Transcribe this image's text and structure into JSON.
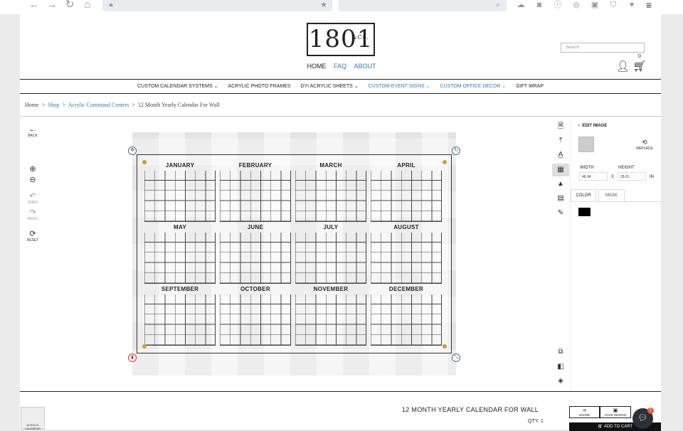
{
  "browser": {
    "back_icon": "arrow-left-icon",
    "forward_icon": "arrow-right-icon",
    "reload_icon": "reload-icon",
    "home_icon": "home-icon"
  },
  "logo": {
    "text": "1801",
    "suffix": "&Co."
  },
  "topnav": {
    "home": "HOME",
    "faq": "FAQ",
    "about": "ABOUT"
  },
  "search": {
    "placeholder": "Search"
  },
  "cart": {
    "count": "0"
  },
  "mainnav": [
    "CUSTOM CALENDAR SYSTEMS ⌄",
    "ACRYLIC PHOTO FRAMES",
    "DYI ACRYLIC SHEETS ⌄",
    "CUSTOM EVENT SIGNS ⌄",
    "CUSTOM OFFICE DECOR ⌄",
    "GIFT WRAP"
  ],
  "breadcrumb": {
    "home": "Home",
    "shop": "Shop",
    "category": "Acrylic Command Centers",
    "current": "12 Month Yearly Calendar For Wall",
    "sep": ">"
  },
  "left_tools": {
    "back": "BACK",
    "undo": "UNDO",
    "redo": "REDO",
    "reset": "RESET"
  },
  "calendar": {
    "months": [
      "JANUARY",
      "FEBRUARY",
      "MARCH",
      "APRIL",
      "MAY",
      "JUNE",
      "JULY",
      "AUGUST",
      "SEPTEMBER",
      "OCTOBER",
      "NOVEMBER",
      "DECEMBER"
    ]
  },
  "panel": {
    "edit_image": "EDIT IMAGE",
    "replace": "REPLACE",
    "width_label": "WIDTH",
    "height_label": "HEIGHT",
    "width_value": "46.04",
    "height_value": "29.01",
    "x": "X",
    "unit": "IN",
    "tab_color": "COLOR",
    "tab_mask": "MASK",
    "swatch_color": "#000000"
  },
  "product": {
    "title": "12 MONTH YEARLY CALENDAR FOR WALL",
    "qty": "QTY: 1",
    "thumb_label": "ACRYLIC CALENDAR"
  },
  "actions": {
    "share": "SHARE",
    "save_design": "SAVE DESIGN",
    "add_to_cart": "ADD TO CART"
  },
  "chat": {
    "badge": "1"
  }
}
